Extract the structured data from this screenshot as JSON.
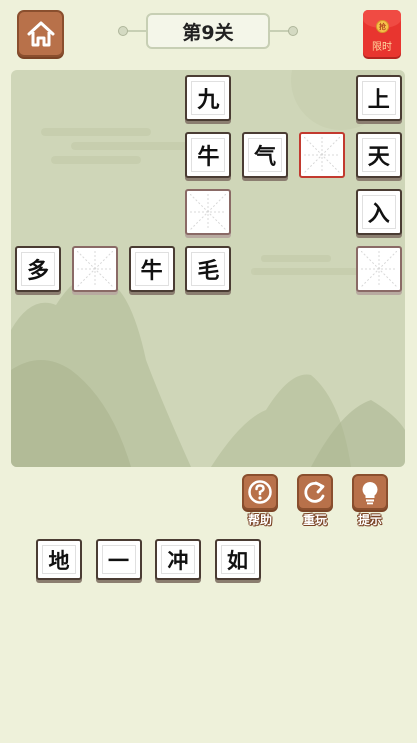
{
  "header": {
    "home_icon": "home-icon",
    "level_title": "第9关",
    "redpacket_coin": "抢",
    "redpacket_label": "限时"
  },
  "board": {
    "cells": [
      {
        "row": 0,
        "col": 3,
        "char": "九",
        "state": "filled"
      },
      {
        "row": 0,
        "col": 6,
        "char": "上",
        "state": "filled"
      },
      {
        "row": 1,
        "col": 3,
        "char": "牛",
        "state": "filled"
      },
      {
        "row": 1,
        "col": 4,
        "char": "气",
        "state": "filled"
      },
      {
        "row": 1,
        "col": 5,
        "char": "",
        "state": "selected"
      },
      {
        "row": 1,
        "col": 6,
        "char": "天",
        "state": "filled"
      },
      {
        "row": 2,
        "col": 3,
        "char": "",
        "state": "empty"
      },
      {
        "row": 2,
        "col": 6,
        "char": "入",
        "state": "filled"
      },
      {
        "row": 3,
        "col": 0,
        "char": "多",
        "state": "filled"
      },
      {
        "row": 3,
        "col": 1,
        "char": "",
        "state": "empty"
      },
      {
        "row": 3,
        "col": 2,
        "char": "牛",
        "state": "filled"
      },
      {
        "row": 3,
        "col": 3,
        "char": "毛",
        "state": "filled"
      },
      {
        "row": 3,
        "col": 6,
        "char": "",
        "state": "empty"
      }
    ]
  },
  "actions": {
    "help_label": "帮助",
    "replay_label": "重玩",
    "hint_label": "提示"
  },
  "candidates": [
    "地",
    "一",
    "冲",
    "如"
  ],
  "colors": {
    "background": "#eef1da",
    "board": "#cfd6b8",
    "button_brown": "#b8714a",
    "selected_border": "#c23a2f",
    "redpacket": "#e8352f"
  }
}
